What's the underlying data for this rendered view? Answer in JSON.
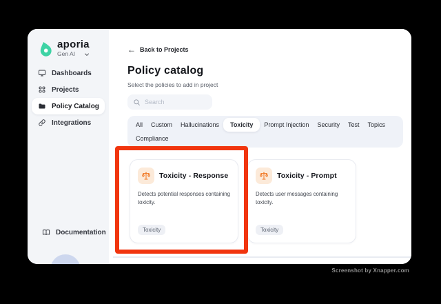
{
  "brand": {
    "name": "aporia",
    "workspace": "Gen AI"
  },
  "sidebar": {
    "items": [
      {
        "label": "Dashboards",
        "icon": "dashboard-icon",
        "selected": false
      },
      {
        "label": "Projects",
        "icon": "projects-grid-icon",
        "selected": false
      },
      {
        "label": "Policy Catalog",
        "icon": "folder-icon",
        "selected": true
      },
      {
        "label": "Integrations",
        "icon": "link-icon",
        "selected": false
      }
    ],
    "documentation_label": "Documentation"
  },
  "main": {
    "back_arrow": "←",
    "back_link": "Back to Projects",
    "title": "Policy catalog",
    "subtitle": "Select the policies to add in project",
    "search_placeholder": "Search",
    "tabs": [
      {
        "label": "All",
        "selected": false
      },
      {
        "label": "Custom",
        "selected": false
      },
      {
        "label": "Hallucinations",
        "selected": false
      },
      {
        "label": "Toxicity",
        "selected": true
      },
      {
        "label": "Prompt Injection",
        "selected": false
      },
      {
        "label": "Security",
        "selected": false
      },
      {
        "label": "Test",
        "selected": false
      },
      {
        "label": "Topics",
        "selected": false
      },
      {
        "label": "Compliance",
        "selected": false
      }
    ],
    "cards": [
      {
        "title": "Toxicity - Response",
        "description": "Detects potential responses containing toxicity.",
        "tag": "Toxicity",
        "icon": "scales-icon"
      },
      {
        "title": "Toxicity - Prompt",
        "description": "Detects user messages containing toxicity.",
        "tag": "Toxicity",
        "icon": "scales-icon"
      }
    ]
  },
  "colors": {
    "accent_teal": "#3ed3a5",
    "highlight_red": "#f1350e",
    "icon_orange": "#f0741e"
  },
  "watermark": "Screenshot by Xnapper.com"
}
